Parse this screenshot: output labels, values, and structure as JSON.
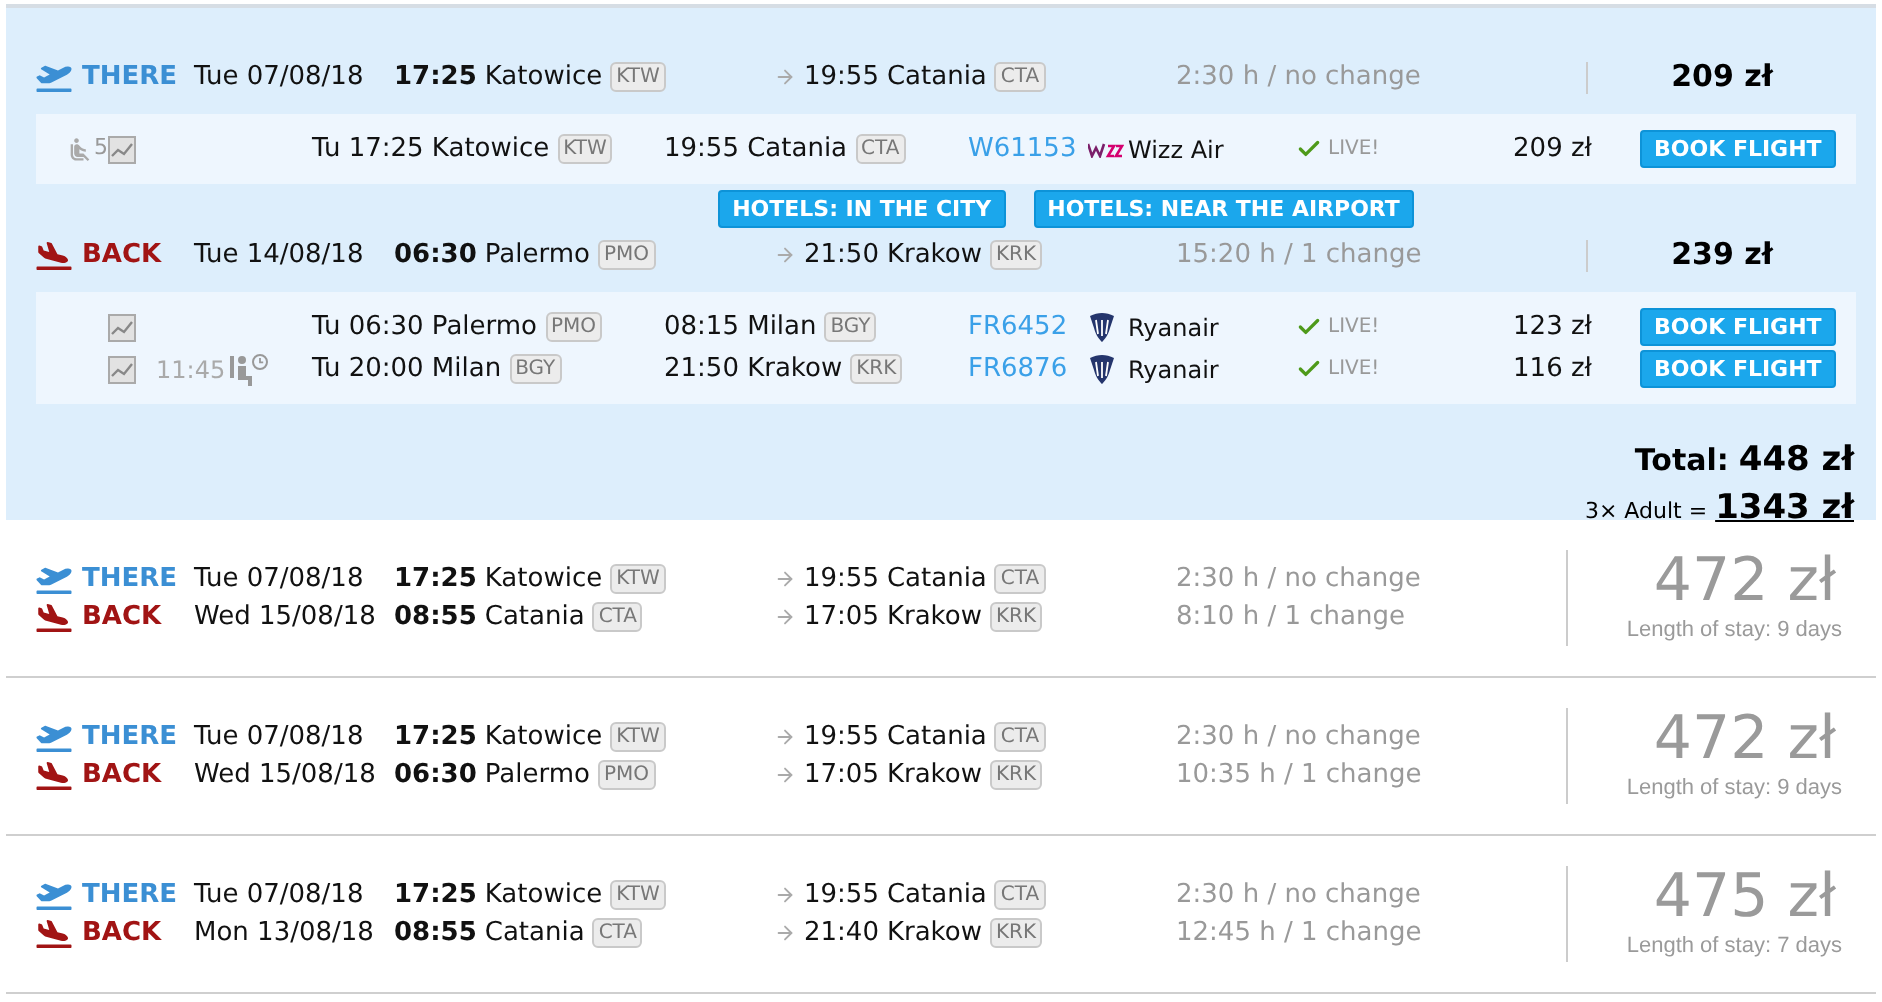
{
  "selected_trip": {
    "legs": [
      {
        "kind": "there",
        "label": "THERE",
        "date": "Tue 07/08/18",
        "time": "17:25",
        "from": "Katowice",
        "from_code": "KTW",
        "arrival_time": "19:55",
        "to": "Catania",
        "to_code": "CTA",
        "duration": "2:30 h / no change",
        "price": "209 zł",
        "segments": [
          {
            "seats": "5",
            "departure": "Tu 17:25 Katowice",
            "dep_code": "KTW",
            "arrival": "19:55 Catania",
            "arr_code": "CTA",
            "flight": "W61153",
            "kind": "wizz",
            "airline": "Wizz Air",
            "live": "LIVE!",
            "price": "209 zł",
            "button": "BOOK FLIGHT"
          }
        ]
      },
      {
        "kind": "back",
        "label": "BACK",
        "date": "Tue 14/08/18",
        "time": "06:30",
        "from": "Palermo",
        "from_code": "PMO",
        "arrival_time": "21:50",
        "to": "Krakow",
        "to_code": "KRK",
        "duration": "15:20 h / 1 change",
        "price": "239 zł",
        "segments": [
          {
            "departure": "Tu 06:30 Palermo",
            "dep_code": "PMO",
            "arrival": "08:15 Milan",
            "arr_code": "BGY",
            "flight": "FR6452",
            "kind": "ryanair",
            "airline": "Ryanair",
            "live": "LIVE!",
            "price": "123 zł",
            "button": "BOOK FLIGHT"
          },
          {
            "layover": "11:45",
            "departure": "Tu 20:00 Milan",
            "dep_code": "BGY",
            "arrival": "21:50 Krakow",
            "arr_code": "KRK",
            "flight": "FR6876",
            "kind": "ryanair",
            "airline": "Ryanair",
            "live": "LIVE!",
            "price": "116 zł",
            "button": "BOOK FLIGHT"
          }
        ]
      }
    ],
    "hotel_buttons": [
      "HOTELS: IN THE CITY",
      "HOTELS: NEAR THE AIRPORT"
    ],
    "total_label": "Total:",
    "total": "448 zł",
    "passengers": "3× Adult =",
    "grand_total": "1343 zł"
  },
  "other_trips": [
    {
      "legs": [
        {
          "kind": "there",
          "label": "THERE",
          "date": "Tue 07/08/18",
          "time": "17:25",
          "from": "Katowice",
          "from_code": "KTW",
          "arrival_time": "19:55",
          "to": "Catania",
          "to_code": "CTA",
          "duration": "2:30 h / no change"
        },
        {
          "kind": "back",
          "label": "BACK",
          "date": "Wed 15/08/18",
          "time": "08:55",
          "from": "Catania",
          "from_code": "CTA",
          "arrival_time": "17:05",
          "to": "Krakow",
          "to_code": "KRK",
          "duration": "8:10 h / 1 change"
        }
      ],
      "price": "472 zł",
      "stay": "Length of stay: 9 days"
    },
    {
      "legs": [
        {
          "kind": "there",
          "label": "THERE",
          "date": "Tue 07/08/18",
          "time": "17:25",
          "from": "Katowice",
          "from_code": "KTW",
          "arrival_time": "19:55",
          "to": "Catania",
          "to_code": "CTA",
          "duration": "2:30 h / no change"
        },
        {
          "kind": "back",
          "label": "BACK",
          "date": "Wed 15/08/18",
          "time": "06:30",
          "from": "Palermo",
          "from_code": "PMO",
          "arrival_time": "17:05",
          "to": "Krakow",
          "to_code": "KRK",
          "duration": "10:35 h / 1 change"
        }
      ],
      "price": "472 zł",
      "stay": "Length of stay: 9 days"
    },
    {
      "legs": [
        {
          "kind": "there",
          "label": "THERE",
          "date": "Tue 07/08/18",
          "time": "17:25",
          "from": "Katowice",
          "from_code": "KTW",
          "arrival_time": "19:55",
          "to": "Catania",
          "to_code": "CTA",
          "duration": "2:30 h / no change"
        },
        {
          "kind": "back",
          "label": "BACK",
          "date": "Mon 13/08/18",
          "time": "08:55",
          "from": "Catania",
          "from_code": "CTA",
          "arrival_time": "21:40",
          "to": "Krakow",
          "to_code": "KRK",
          "duration": "12:45 h / 1 change"
        }
      ],
      "price": "475 zł",
      "stay": "Length of stay: 7 days"
    }
  ]
}
